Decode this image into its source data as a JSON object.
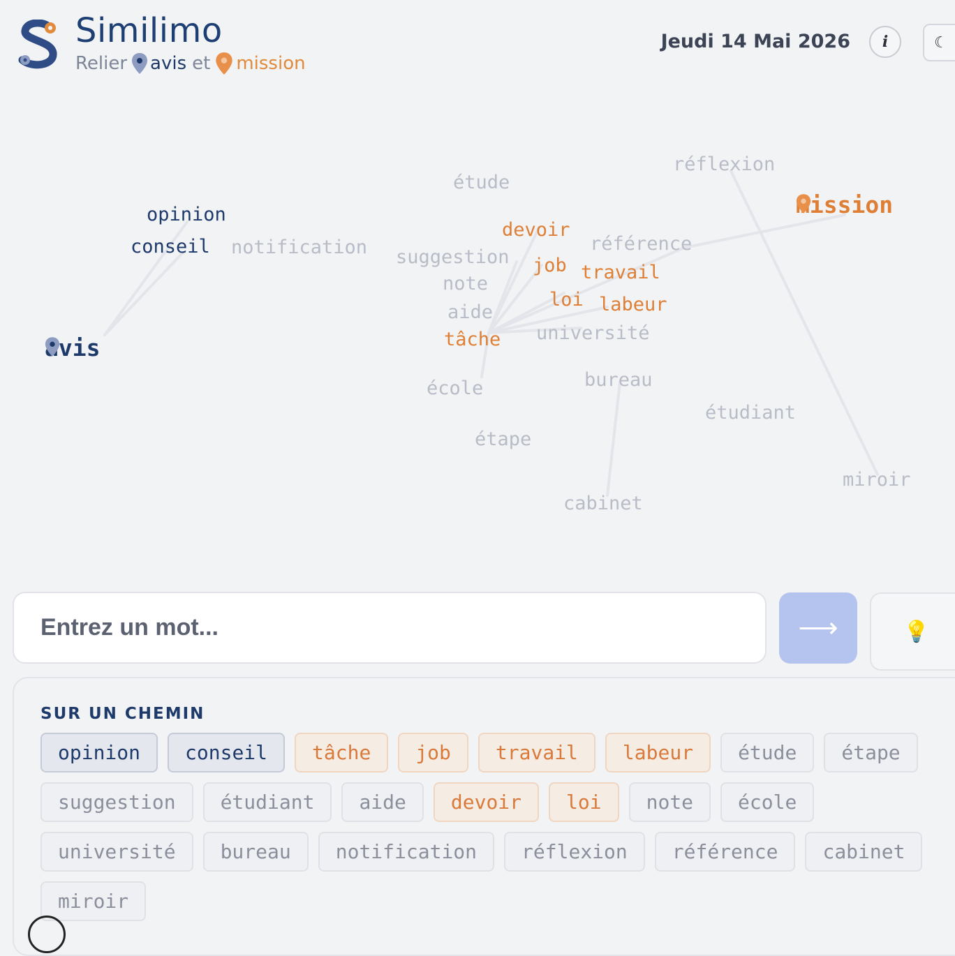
{
  "header": {
    "title": "Similimo",
    "subtitle_prefix": "Relier",
    "start_word": "avis",
    "connector": "et",
    "end_word": "mission",
    "date": "Jeudi 14 Mai 2026",
    "info_label": "i",
    "theme_icon": "☾"
  },
  "colors": {
    "start": "#1e3a6b",
    "end": "#de7f35",
    "neutral": "#b8bcc7",
    "submit": "#b4c4ee"
  },
  "graph": {
    "words": [
      {
        "text": "avis",
        "kind": "start"
      },
      {
        "text": "mission",
        "kind": "end"
      },
      {
        "text": "opinion",
        "kind": "blue"
      },
      {
        "text": "conseil",
        "kind": "blue"
      },
      {
        "text": "notification",
        "kind": "gray"
      },
      {
        "text": "étude",
        "kind": "gray"
      },
      {
        "text": "réflexion",
        "kind": "gray"
      },
      {
        "text": "devoir",
        "kind": "orange"
      },
      {
        "text": "référence",
        "kind": "gray"
      },
      {
        "text": "suggestion",
        "kind": "gray"
      },
      {
        "text": "job",
        "kind": "orange"
      },
      {
        "text": "travail",
        "kind": "orange"
      },
      {
        "text": "note",
        "kind": "gray"
      },
      {
        "text": "loi",
        "kind": "orange"
      },
      {
        "text": "labeur",
        "kind": "orange"
      },
      {
        "text": "aide",
        "kind": "gray"
      },
      {
        "text": "tâche",
        "kind": "orange"
      },
      {
        "text": "université",
        "kind": "gray"
      },
      {
        "text": "bureau",
        "kind": "gray"
      },
      {
        "text": "école",
        "kind": "gray"
      },
      {
        "text": "étudiant",
        "kind": "gray"
      },
      {
        "text": "étape",
        "kind": "gray"
      },
      {
        "text": "miroir",
        "kind": "gray"
      },
      {
        "text": "cabinet",
        "kind": "gray"
      }
    ]
  },
  "input": {
    "placeholder": "Entrez un mot...",
    "submit_icon": "⟶",
    "hint_icon": "💡"
  },
  "path_panel": {
    "title": "SUR UN CHEMIN",
    "chips": [
      {
        "text": "opinion",
        "kind": "blue"
      },
      {
        "text": "conseil",
        "kind": "blue"
      },
      {
        "text": "tâche",
        "kind": "orange"
      },
      {
        "text": "job",
        "kind": "orange"
      },
      {
        "text": "travail",
        "kind": "orange"
      },
      {
        "text": "labeur",
        "kind": "orange"
      },
      {
        "text": "étude",
        "kind": "gray"
      },
      {
        "text": "étape",
        "kind": "gray"
      },
      {
        "text": "suggestion",
        "kind": "gray"
      },
      {
        "text": "étudiant",
        "kind": "gray"
      },
      {
        "text": "aide",
        "kind": "gray"
      },
      {
        "text": "devoir",
        "kind": "orange"
      },
      {
        "text": "loi",
        "kind": "orange"
      },
      {
        "text": "note",
        "kind": "gray"
      },
      {
        "text": "école",
        "kind": "gray"
      },
      {
        "text": "université",
        "kind": "gray"
      },
      {
        "text": "bureau",
        "kind": "gray"
      },
      {
        "text": "notification",
        "kind": "gray"
      },
      {
        "text": "réflexion",
        "kind": "gray"
      },
      {
        "text": "référence",
        "kind": "gray"
      },
      {
        "text": "cabinet",
        "kind": "gray"
      },
      {
        "text": "miroir",
        "kind": "gray"
      }
    ]
  }
}
